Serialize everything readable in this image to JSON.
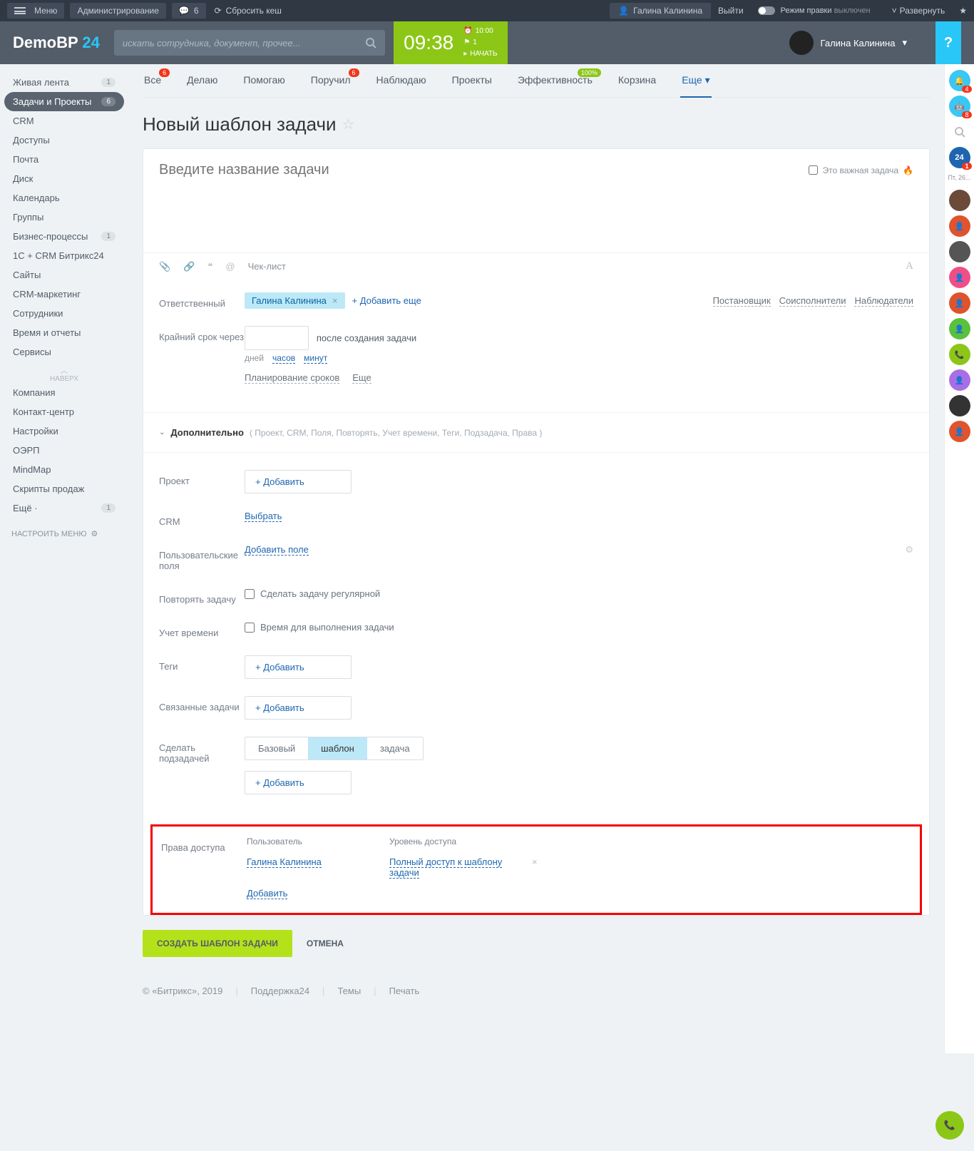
{
  "topbar": {
    "menu": "Меню",
    "admin": "Администрирование",
    "msg_count": "6",
    "reset": "Сбросить кеш",
    "user": "Галина Калинина",
    "exit": "Выйти",
    "edit_mode": "Режим правки",
    "edit_state": "выключен",
    "expand": "Развернуть"
  },
  "header": {
    "logo_a": "DemoBP",
    "logo_b": " 24",
    "search_ph": "искать сотрудника, документ, прочее...",
    "time": "09:38",
    "clock_t": "10:00",
    "clock_f": "1",
    "clock_start": "НАЧАТЬ",
    "user": "Галина Калинина"
  },
  "sidebar": {
    "items": [
      {
        "label": "Живая лента",
        "badge": "1"
      },
      {
        "label": "Задачи и Проекты",
        "badge": "6",
        "active": true
      },
      {
        "label": "CRM"
      },
      {
        "label": "Доступы"
      },
      {
        "label": "Почта"
      },
      {
        "label": "Диск"
      },
      {
        "label": "Календарь"
      },
      {
        "label": "Группы"
      },
      {
        "label": "Бизнес-процессы",
        "badge": "1"
      },
      {
        "label": "1С + CRM Битрикс24"
      },
      {
        "label": "Сайты"
      },
      {
        "label": "CRM-маркетинг"
      },
      {
        "label": "Сотрудники"
      },
      {
        "label": "Время и отчеты"
      },
      {
        "label": "Сервисы"
      },
      {
        "label": "Компания"
      },
      {
        "label": "Контакт-центр"
      },
      {
        "label": "Настройки"
      },
      {
        "label": "ОЭРП"
      },
      {
        "label": "MindMap"
      },
      {
        "label": "Скрипты продаж"
      },
      {
        "label": "Ещё ·",
        "badge": "1"
      }
    ],
    "up": "НАВЕРХ",
    "settings": "НАСТРОИТЬ МЕНЮ"
  },
  "tabs": [
    {
      "label": "Все",
      "badge": "6"
    },
    {
      "label": "Делаю"
    },
    {
      "label": "Помогаю"
    },
    {
      "label": "Поручил",
      "badge": "6"
    },
    {
      "label": "Наблюдаю"
    },
    {
      "label": "Проекты"
    },
    {
      "label": "Эффективность",
      "badge": "100%",
      "green": true
    },
    {
      "label": "Корзина"
    },
    {
      "label": "Еще ▾",
      "active": true
    }
  ],
  "page": {
    "title": "Новый шаблон задачи"
  },
  "task": {
    "title_ph": "Введите название задачи",
    "important": "Это важная задача",
    "checklist": "Чек-лист",
    "resp_label": "Ответственный",
    "resp_value": "Галина Калинина",
    "add_more": "+ Добавить еще",
    "roles": [
      "Постановщик",
      "Соисполнители",
      "Наблюдатели"
    ],
    "deadline_label": "Крайний срок через",
    "deadline_after": "после создания задачи",
    "units": [
      "дней",
      "часов",
      "минут"
    ],
    "plan": [
      "Планирование сроков",
      "Еще"
    ],
    "addl": "Дополнительно",
    "addl_opts": "( Проект,  CRM,  Поля,  Повторять,  Учет времени,  Теги,  Подзадача,  Права )",
    "project": "Проект",
    "add_btn": "+  Добавить",
    "crm": "CRM",
    "crm_select": "Выбрать",
    "uf": "Пользователь­ские поля",
    "uf_add": "Добавить поле",
    "repeat": "Повторять задачу",
    "repeat_chk": "Сделать задачу регулярной",
    "time": "Учет времени",
    "time_chk": "Время для выполнения задачи",
    "tags": "Теги",
    "linked": "Связанные задачи",
    "subtask": "Сделать подзадачей",
    "seg": [
      "Базовый",
      "шаблон",
      "задача"
    ],
    "rights": {
      "label": "Права доступа",
      "h_user": "Пользователь",
      "h_level": "Уровень доступа",
      "user": "Галина Калинина",
      "level": "Полный доступ к шаблону задачи",
      "add": "Добавить"
    }
  },
  "buttons": {
    "create": "СОЗДАТЬ ШАБЛОН ЗАДАЧИ",
    "cancel": "ОТМЕНА"
  },
  "footer": {
    "copy": "© «Битрикс», 2019",
    "support": "Поддержка24",
    "themes": "Темы",
    "print": "Печать"
  },
  "rpanel": {
    "badges": [
      "4",
      "8"
    ],
    "b24": "24",
    "b24b": "1",
    "date": "Пт, 26..."
  }
}
